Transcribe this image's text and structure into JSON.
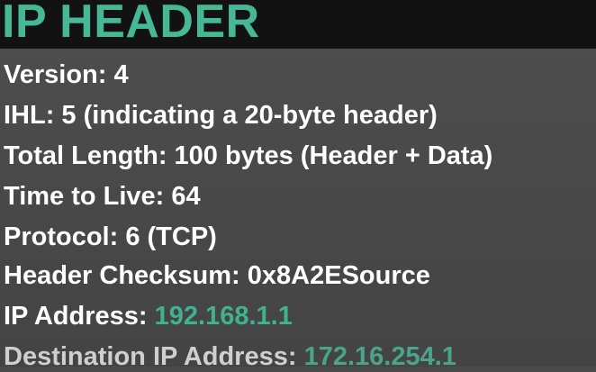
{
  "title": "IP HEADER",
  "lines": [
    {
      "text": "Version: 4"
    },
    {
      "text": "IHL: 5 (indicating a 20-byte header)"
    },
    {
      "text": "Total Length: 100 bytes (Header + Data)"
    },
    {
      "text": "Time to Live: 64"
    },
    {
      "text": "Protocol: 6 (TCP)"
    },
    {
      "text": "Header Checksum: 0x8A2ESource"
    },
    {
      "label": "IP Address: ",
      "value": "192.168.1.1"
    },
    {
      "label": "Destination IP Address: ",
      "value": "172.16.254.1"
    }
  ],
  "colors": {
    "accent": "#3fb28f",
    "title": "#46b896",
    "background": "#4a4a4a",
    "title_bar": "#121212"
  }
}
